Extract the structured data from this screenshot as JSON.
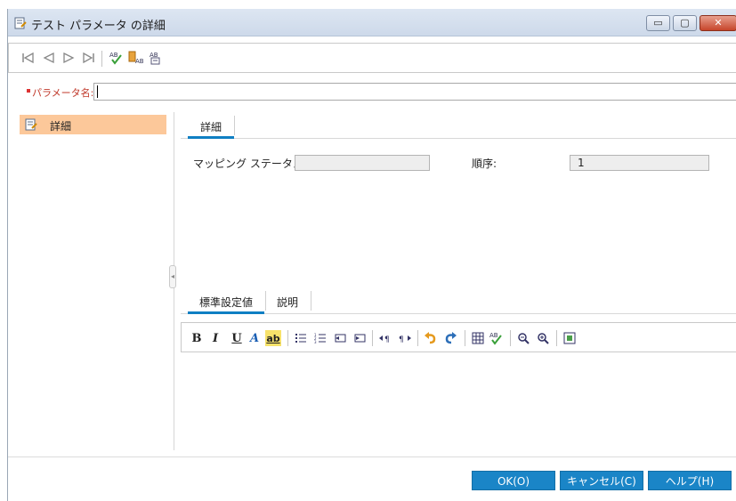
{
  "window": {
    "title": "テスト パラメータ の詳細",
    "controls": {
      "minimize": "▭",
      "maximize": "▢",
      "close": "✕"
    }
  },
  "toolbar": {
    "icons": [
      "first-record-icon",
      "previous-record-icon",
      "next-record-icon",
      "last-record-icon",
      "spell-check-icon",
      "thesaurus-icon",
      "spelling-options-icon"
    ]
  },
  "param": {
    "label": "パラメータ名:",
    "value": ""
  },
  "sidebar": {
    "items": [
      {
        "label": "詳細"
      }
    ]
  },
  "details_tab": {
    "label": "詳細"
  },
  "fields": {
    "mapping_status_label": "マッピング ステータス:",
    "mapping_status_value": "",
    "order_label": "順序:",
    "order_value": "1"
  },
  "lower_tabs": [
    {
      "label": "標準設定値"
    },
    {
      "label": "説明"
    }
  ],
  "rte": {
    "bold": "B",
    "italic": "I",
    "underline": "U",
    "font_color": "A",
    "highlight": "ab"
  },
  "buttons": {
    "ok": "OK(O)",
    "cancel": "キャンセル(C)",
    "help": "ヘルプ(H)"
  },
  "colors": {
    "accent": "#1a85c7",
    "sidebar_selected": "#fcc89a",
    "required": "#c0392b"
  }
}
